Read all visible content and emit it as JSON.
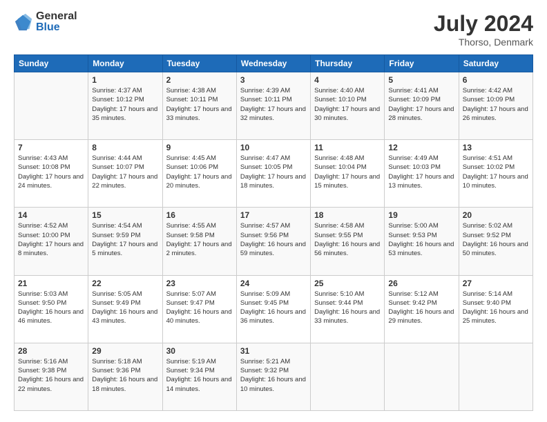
{
  "logo": {
    "general": "General",
    "blue": "Blue"
  },
  "header": {
    "month_year": "July 2024",
    "location": "Thorso, Denmark"
  },
  "days_of_week": [
    "Sunday",
    "Monday",
    "Tuesday",
    "Wednesday",
    "Thursday",
    "Friday",
    "Saturday"
  ],
  "weeks": [
    [
      {
        "num": "",
        "empty": true
      },
      {
        "num": "1",
        "sunrise": "Sunrise: 4:37 AM",
        "sunset": "Sunset: 10:12 PM",
        "daylight": "Daylight: 17 hours and 35 minutes."
      },
      {
        "num": "2",
        "sunrise": "Sunrise: 4:38 AM",
        "sunset": "Sunset: 10:11 PM",
        "daylight": "Daylight: 17 hours and 33 minutes."
      },
      {
        "num": "3",
        "sunrise": "Sunrise: 4:39 AM",
        "sunset": "Sunset: 10:11 PM",
        "daylight": "Daylight: 17 hours and 32 minutes."
      },
      {
        "num": "4",
        "sunrise": "Sunrise: 4:40 AM",
        "sunset": "Sunset: 10:10 PM",
        "daylight": "Daylight: 17 hours and 30 minutes."
      },
      {
        "num": "5",
        "sunrise": "Sunrise: 4:41 AM",
        "sunset": "Sunset: 10:09 PM",
        "daylight": "Daylight: 17 hours and 28 minutes."
      },
      {
        "num": "6",
        "sunrise": "Sunrise: 4:42 AM",
        "sunset": "Sunset: 10:09 PM",
        "daylight": "Daylight: 17 hours and 26 minutes."
      }
    ],
    [
      {
        "num": "7",
        "sunrise": "Sunrise: 4:43 AM",
        "sunset": "Sunset: 10:08 PM",
        "daylight": "Daylight: 17 hours and 24 minutes."
      },
      {
        "num": "8",
        "sunrise": "Sunrise: 4:44 AM",
        "sunset": "Sunset: 10:07 PM",
        "daylight": "Daylight: 17 hours and 22 minutes."
      },
      {
        "num": "9",
        "sunrise": "Sunrise: 4:45 AM",
        "sunset": "Sunset: 10:06 PM",
        "daylight": "Daylight: 17 hours and 20 minutes."
      },
      {
        "num": "10",
        "sunrise": "Sunrise: 4:47 AM",
        "sunset": "Sunset: 10:05 PM",
        "daylight": "Daylight: 17 hours and 18 minutes."
      },
      {
        "num": "11",
        "sunrise": "Sunrise: 4:48 AM",
        "sunset": "Sunset: 10:04 PM",
        "daylight": "Daylight: 17 hours and 15 minutes."
      },
      {
        "num": "12",
        "sunrise": "Sunrise: 4:49 AM",
        "sunset": "Sunset: 10:03 PM",
        "daylight": "Daylight: 17 hours and 13 minutes."
      },
      {
        "num": "13",
        "sunrise": "Sunrise: 4:51 AM",
        "sunset": "Sunset: 10:02 PM",
        "daylight": "Daylight: 17 hours and 10 minutes."
      }
    ],
    [
      {
        "num": "14",
        "sunrise": "Sunrise: 4:52 AM",
        "sunset": "Sunset: 10:00 PM",
        "daylight": "Daylight: 17 hours and 8 minutes."
      },
      {
        "num": "15",
        "sunrise": "Sunrise: 4:54 AM",
        "sunset": "Sunset: 9:59 PM",
        "daylight": "Daylight: 17 hours and 5 minutes."
      },
      {
        "num": "16",
        "sunrise": "Sunrise: 4:55 AM",
        "sunset": "Sunset: 9:58 PM",
        "daylight": "Daylight: 17 hours and 2 minutes."
      },
      {
        "num": "17",
        "sunrise": "Sunrise: 4:57 AM",
        "sunset": "Sunset: 9:56 PM",
        "daylight": "Daylight: 16 hours and 59 minutes."
      },
      {
        "num": "18",
        "sunrise": "Sunrise: 4:58 AM",
        "sunset": "Sunset: 9:55 PM",
        "daylight": "Daylight: 16 hours and 56 minutes."
      },
      {
        "num": "19",
        "sunrise": "Sunrise: 5:00 AM",
        "sunset": "Sunset: 9:53 PM",
        "daylight": "Daylight: 16 hours and 53 minutes."
      },
      {
        "num": "20",
        "sunrise": "Sunrise: 5:02 AM",
        "sunset": "Sunset: 9:52 PM",
        "daylight": "Daylight: 16 hours and 50 minutes."
      }
    ],
    [
      {
        "num": "21",
        "sunrise": "Sunrise: 5:03 AM",
        "sunset": "Sunset: 9:50 PM",
        "daylight": "Daylight: 16 hours and 46 minutes."
      },
      {
        "num": "22",
        "sunrise": "Sunrise: 5:05 AM",
        "sunset": "Sunset: 9:49 PM",
        "daylight": "Daylight: 16 hours and 43 minutes."
      },
      {
        "num": "23",
        "sunrise": "Sunrise: 5:07 AM",
        "sunset": "Sunset: 9:47 PM",
        "daylight": "Daylight: 16 hours and 40 minutes."
      },
      {
        "num": "24",
        "sunrise": "Sunrise: 5:09 AM",
        "sunset": "Sunset: 9:45 PM",
        "daylight": "Daylight: 16 hours and 36 minutes."
      },
      {
        "num": "25",
        "sunrise": "Sunrise: 5:10 AM",
        "sunset": "Sunset: 9:44 PM",
        "daylight": "Daylight: 16 hours and 33 minutes."
      },
      {
        "num": "26",
        "sunrise": "Sunrise: 5:12 AM",
        "sunset": "Sunset: 9:42 PM",
        "daylight": "Daylight: 16 hours and 29 minutes."
      },
      {
        "num": "27",
        "sunrise": "Sunrise: 5:14 AM",
        "sunset": "Sunset: 9:40 PM",
        "daylight": "Daylight: 16 hours and 25 minutes."
      }
    ],
    [
      {
        "num": "28",
        "sunrise": "Sunrise: 5:16 AM",
        "sunset": "Sunset: 9:38 PM",
        "daylight": "Daylight: 16 hours and 22 minutes."
      },
      {
        "num": "29",
        "sunrise": "Sunrise: 5:18 AM",
        "sunset": "Sunset: 9:36 PM",
        "daylight": "Daylight: 16 hours and 18 minutes."
      },
      {
        "num": "30",
        "sunrise": "Sunrise: 5:19 AM",
        "sunset": "Sunset: 9:34 PM",
        "daylight": "Daylight: 16 hours and 14 minutes."
      },
      {
        "num": "31",
        "sunrise": "Sunrise: 5:21 AM",
        "sunset": "Sunset: 9:32 PM",
        "daylight": "Daylight: 16 hours and 10 minutes."
      },
      {
        "num": "",
        "empty": true
      },
      {
        "num": "",
        "empty": true
      },
      {
        "num": "",
        "empty": true
      }
    ]
  ]
}
